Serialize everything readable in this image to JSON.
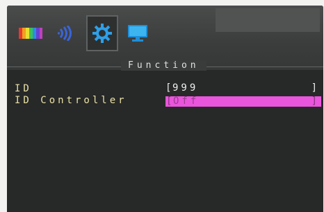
{
  "menu": {
    "icons": [
      {
        "name": "color-icon"
      },
      {
        "name": "audio-icon"
      },
      {
        "name": "function-gear-icon",
        "selected": true
      },
      {
        "name": "display-monitor-icon"
      }
    ],
    "section_title": "Function"
  },
  "rows": {
    "id": {
      "label": "ID",
      "open_bracket": "[",
      "value": "999",
      "close_bracket": "]"
    },
    "id_controller": {
      "label": "ID Controller",
      "open_bracket": "[",
      "value": "Off",
      "close_bracket": "]",
      "highlight_color": "#ea55dd"
    }
  },
  "colors": {
    "label_text": "#e9e2a6",
    "value_text": "#efefef",
    "accent_blue": "#2f9fe8"
  }
}
